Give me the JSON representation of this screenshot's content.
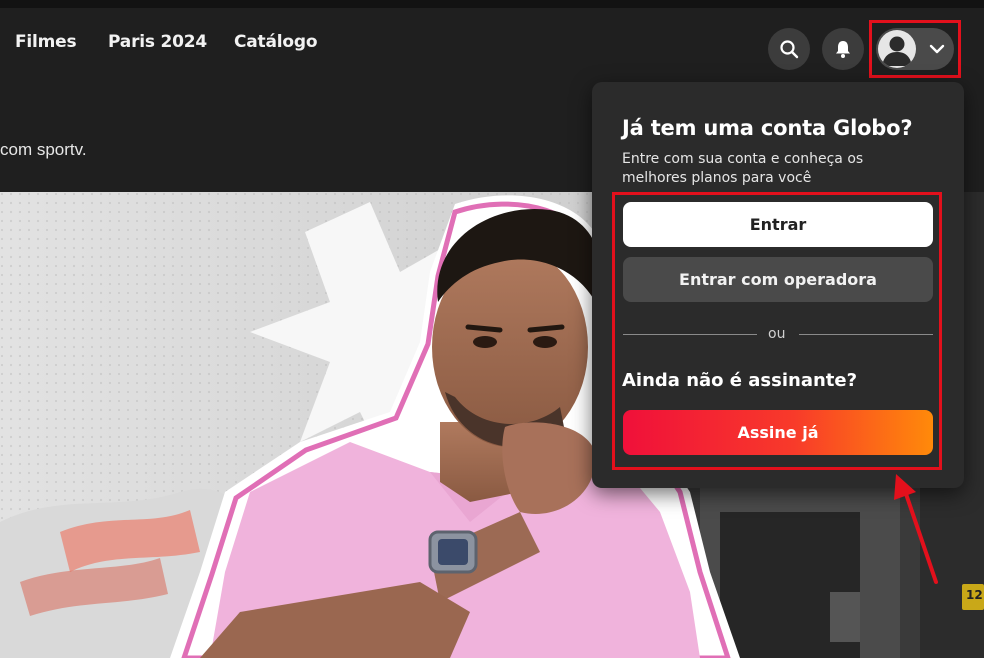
{
  "nav": {
    "items": [
      {
        "label": "Filmes"
      },
      {
        "label": "Paris 2024"
      },
      {
        "label": "Catálogo"
      }
    ]
  },
  "header": {
    "search_icon": "search-icon",
    "bell_icon": "bell-icon",
    "avatar_icon": "user-avatar-icon",
    "chevron_icon": "chevron-down-icon"
  },
  "subtitle": "com sportv.",
  "popover": {
    "title": "Já tem uma conta Globo?",
    "description": "Entre com sua conta e conheça os melhores planos para você",
    "login_label": "Entrar",
    "operator_label": "Entrar com operadora",
    "or_label": "ou",
    "subscribe_heading": "Ainda não é assinante?",
    "subscribe_label": "Assine já"
  },
  "hero": {
    "badge_text": "12"
  },
  "colors": {
    "highlight_red": "#e3101c",
    "gradient_start": "#f0103a",
    "gradient_end": "#ff8a0a"
  }
}
